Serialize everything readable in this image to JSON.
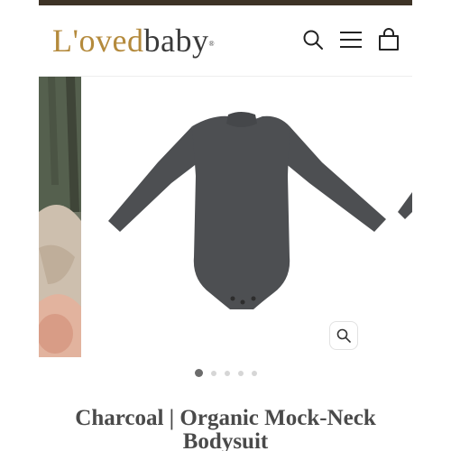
{
  "brand": {
    "logo_part1": "L'oved",
    "logo_part2": "baby",
    "logo_mark": "®"
  },
  "header": {
    "icons": [
      "search-icon",
      "menu-icon",
      "cart-icon"
    ]
  },
  "gallery": {
    "total_images": 5,
    "active_index": 0,
    "zoom_icon": "zoom-icon"
  },
  "product": {
    "title": "Charcoal | Organic Mock-Neck Bodysuit"
  },
  "colors": {
    "top_bar": "#3e3326",
    "logo_gold": "#b48a3c",
    "logo_dark": "#3a3a3a",
    "product_charcoal": "#4d4f52",
    "dot_active": "#6c6c6c",
    "dot_inactive": "#d6d6d6"
  }
}
